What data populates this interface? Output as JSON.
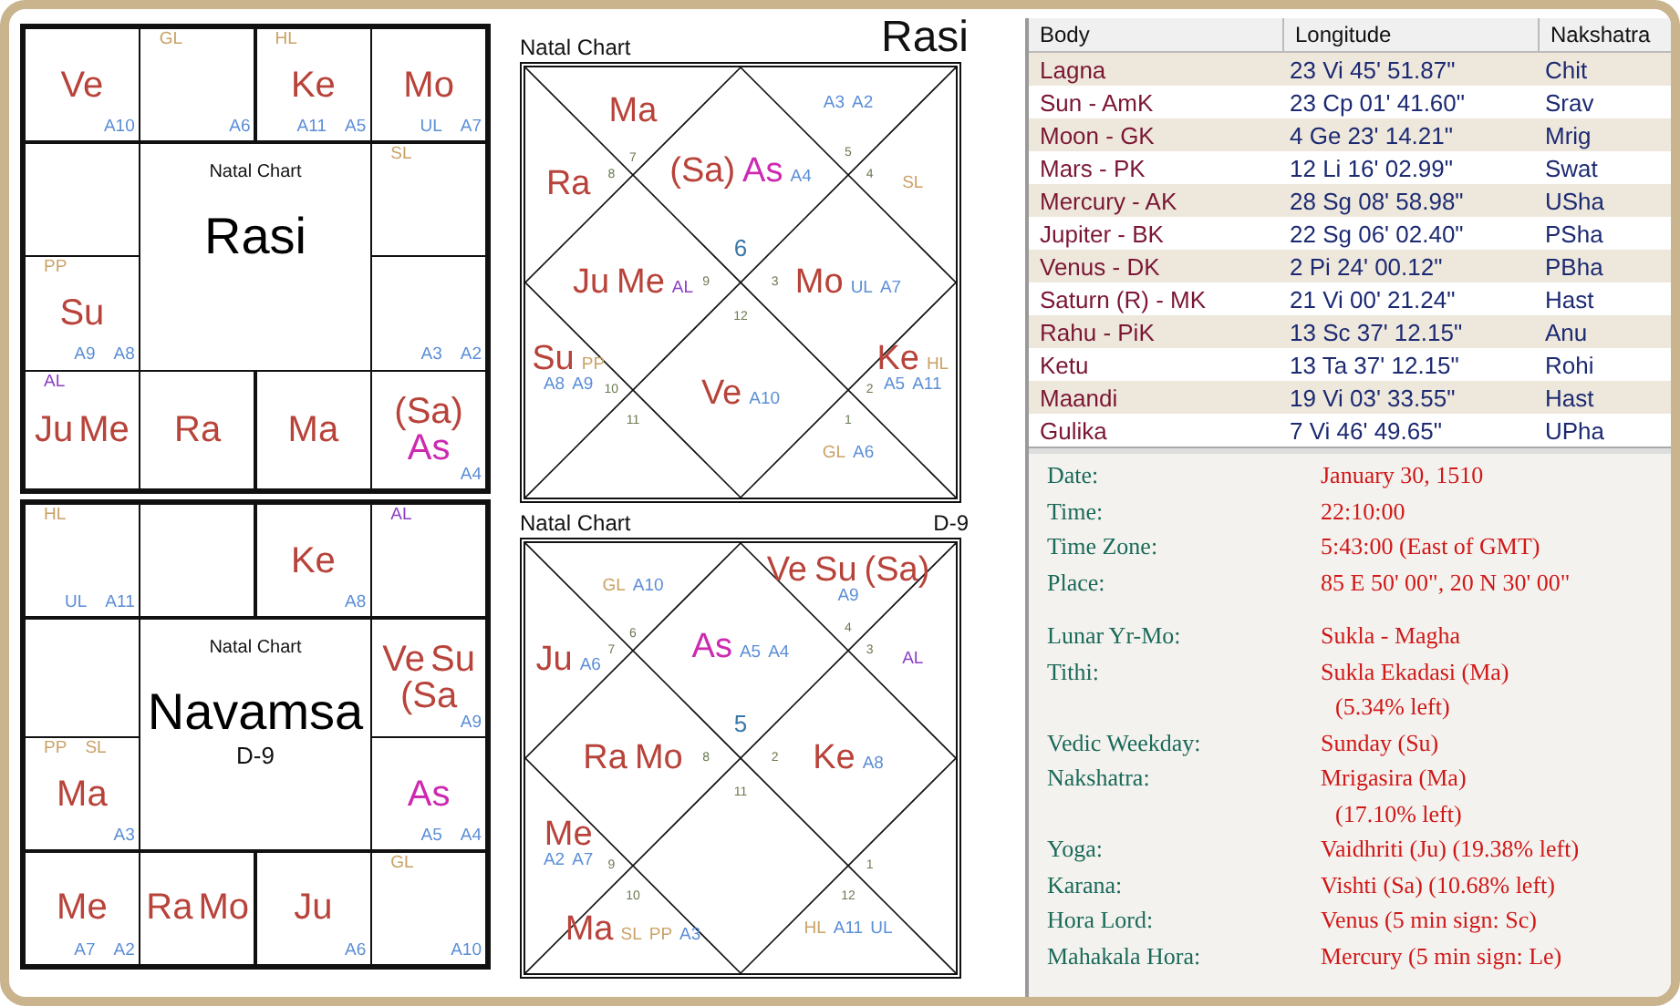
{
  "south_charts": [
    {
      "title": "Natal Chart",
      "name": "Rasi",
      "cells": [
        {
          "planets": [
            {
              "text": "Ve",
              "color": "#b8433a"
            }
          ],
          "bottom": [
            {
              "text": "A10",
              "color": "#5b8ed6"
            }
          ]
        },
        {
          "top": [
            {
              "text": "GL",
              "color": "#c9a266"
            }
          ],
          "bottom": [
            {
              "text": "A6",
              "color": "#5b8ed6"
            }
          ]
        },
        {
          "top": [
            {
              "text": "HL",
              "color": "#c9a266"
            }
          ],
          "planets": [
            {
              "text": "Ke",
              "color": "#b8433a"
            }
          ],
          "bottom": [
            {
              "text": "A11",
              "color": "#5b8ed6"
            },
            {
              "text": "A5",
              "color": "#5b8ed6"
            }
          ]
        },
        {
          "planets": [
            {
              "text": "Mo",
              "color": "#b8433a"
            }
          ],
          "bottom": [
            {
              "text": "UL",
              "color": "#5b8ed6"
            },
            {
              "text": "A7",
              "color": "#5b8ed6"
            }
          ]
        },
        {},
        {
          "top": [
            {
              "text": "SL",
              "color": "#c9a266"
            }
          ]
        },
        {
          "top": [
            {
              "text": "PP",
              "color": "#c9a266"
            }
          ],
          "planets": [
            {
              "text": "Su",
              "color": "#b8433a"
            }
          ],
          "bottom": [
            {
              "text": "A9",
              "color": "#5b8ed6"
            },
            {
              "text": "A8",
              "color": "#5b8ed6"
            }
          ]
        },
        {
          "bottom": [
            {
              "text": "A3",
              "color": "#5b8ed6"
            },
            {
              "text": "A2",
              "color": "#5b8ed6"
            }
          ]
        },
        {
          "top": [
            {
              "text": "AL",
              "color": "#8b3fc4"
            }
          ],
          "planets": [
            {
              "text": "Ju",
              "color": "#b8433a"
            },
            {
              "text": "Me",
              "color": "#b8433a"
            }
          ]
        },
        {
          "planets": [
            {
              "text": "Ra",
              "color": "#b8433a"
            }
          ]
        },
        {
          "planets": [
            {
              "text": "Ma",
              "color": "#b8433a"
            }
          ]
        },
        {
          "planets": [
            {
              "text": "(Sa)",
              "color": "#b8433a"
            },
            {
              "text": "As",
              "color": "#cc2ab0"
            }
          ],
          "bottom": [
            {
              "text": "A4",
              "color": "#5b8ed6"
            }
          ]
        }
      ]
    },
    {
      "title": "Natal Chart",
      "name": "Navamsa",
      "subtitle": "D-9",
      "cells": [
        {
          "top": [
            {
              "text": "HL",
              "color": "#c9a266"
            }
          ],
          "bottom": [
            {
              "text": "UL",
              "color": "#5b8ed6"
            },
            {
              "text": "A11",
              "color": "#5b8ed6"
            }
          ]
        },
        {},
        {
          "planets": [
            {
              "text": "Ke",
              "color": "#b8433a"
            }
          ],
          "bottom": [
            {
              "text": "A8",
              "color": "#5b8ed6"
            }
          ]
        },
        {
          "top": [
            {
              "text": "AL",
              "color": "#8b3fc4"
            }
          ]
        },
        {},
        {
          "planets": [
            {
              "text": "Ve",
              "color": "#b8433a"
            },
            {
              "text": "Su",
              "color": "#b8433a"
            },
            {
              "text": "(Sa",
              "color": "#b8433a"
            }
          ],
          "bottom": [
            {
              "text": "A9",
              "color": "#5b8ed6"
            }
          ]
        },
        {
          "top": [
            {
              "text": "PP",
              "color": "#c9a266"
            },
            {
              "text": "SL",
              "color": "#c9a266"
            }
          ],
          "planets": [
            {
              "text": "Ma",
              "color": "#b8433a"
            }
          ],
          "bottom": [
            {
              "text": "A3",
              "color": "#5b8ed6"
            }
          ]
        },
        {
          "planets": [
            {
              "text": "As",
              "color": "#cc2ab0"
            }
          ],
          "bottom": [
            {
              "text": "A5",
              "color": "#5b8ed6"
            },
            {
              "text": "A4",
              "color": "#5b8ed6"
            }
          ]
        },
        {
          "planets": [
            {
              "text": "Me",
              "color": "#b8433a"
            }
          ],
          "bottom": [
            {
              "text": "A7",
              "color": "#5b8ed6"
            },
            {
              "text": "A2",
              "color": "#5b8ed6"
            }
          ]
        },
        {
          "planets": [
            {
              "text": "Ra",
              "color": "#b8433a"
            },
            {
              "text": "Mo",
              "color": "#b8433a"
            }
          ]
        },
        {
          "planets": [
            {
              "text": "Ju",
              "color": "#b8433a"
            }
          ],
          "bottom": [
            {
              "text": "A6",
              "color": "#5b8ed6"
            }
          ]
        },
        {
          "top": [
            {
              "text": "GL",
              "color": "#c9a266"
            }
          ],
          "bottom": [
            {
              "text": "A10",
              "color": "#5b8ed6"
            }
          ]
        }
      ]
    }
  ],
  "north_charts": [
    {
      "title": "Natal Chart",
      "label": "Rasi",
      "kind": "rasi",
      "houses": [
        {
          "sign": "7",
          "planets": [
            {
              "text": "Ma",
              "color": "#b8433a"
            }
          ]
        },
        {
          "sign": "5",
          "labels": [
            {
              "text": "A3",
              "color": "#5b8ed6"
            },
            {
              "text": "A2",
              "color": "#5b8ed6"
            }
          ]
        },
        {
          "sign": "6",
          "planets": [
            {
              "text": "(Sa)",
              "color": "#b8433a"
            },
            {
              "text": "As",
              "color": "#cc2ab0"
            }
          ],
          "labels": [
            {
              "text": "A4",
              "color": "#5b8ed6"
            }
          ]
        },
        {
          "sign": "8",
          "planets": [
            {
              "text": "Ra",
              "color": "#b8433a"
            }
          ]
        },
        {
          "sign": "4",
          "labels": [
            {
              "text": "SL",
              "color": "#c9a266"
            }
          ]
        },
        {
          "sign": "9",
          "planets": [
            {
              "text": "Ju",
              "color": "#b8433a"
            },
            {
              "text": "Me",
              "color": "#b8433a"
            }
          ],
          "labels": [
            {
              "text": "AL",
              "color": "#8b3fc4"
            }
          ]
        },
        {
          "sign": "3",
          "planets": [
            {
              "text": "Mo",
              "color": "#b8433a"
            }
          ],
          "labels": [
            {
              "text": "UL",
              "color": "#5b8ed6"
            },
            {
              "text": "A7",
              "color": "#5b8ed6"
            }
          ]
        },
        {
          "sign": "10",
          "planets": [
            {
              "text": "Su",
              "color": "#b8433a"
            }
          ],
          "labels": [
            {
              "text": "PP",
              "color": "#c9a266"
            },
            {
              "text": "A8",
              "color": "#5b8ed6"
            },
            {
              "text": "A9",
              "color": "#5b8ed6"
            }
          ]
        },
        {
          "sign": "12",
          "planets": [
            {
              "text": "Ve",
              "color": "#b8433a"
            }
          ],
          "labels": [
            {
              "text": "A10",
              "color": "#5b8ed6"
            }
          ]
        },
        {
          "sign": "2",
          "planets": [
            {
              "text": "Ke",
              "color": "#b8433a"
            }
          ],
          "labels": [
            {
              "text": "HL",
              "color": "#c9a266"
            },
            {
              "text": "A5",
              "color": "#5b8ed6"
            },
            {
              "text": "A11",
              "color": "#5b8ed6"
            }
          ]
        },
        {
          "sign": "11"
        },
        {
          "sign": "1",
          "labels": [
            {
              "text": "GL",
              "color": "#c9a266"
            },
            {
              "text": "A6",
              "color": "#5b8ed6"
            }
          ]
        }
      ]
    },
    {
      "title": "Natal Chart",
      "label": "D-9",
      "kind": "varga",
      "houses": [
        {
          "sign": "6",
          "labels": [
            {
              "text": "GL",
              "color": "#c9a266"
            },
            {
              "text": "A10",
              "color": "#5b8ed6"
            }
          ]
        },
        {
          "sign": "4",
          "planets": [
            {
              "text": "Ve",
              "color": "#b8433a"
            },
            {
              "text": "Su",
              "color": "#b8433a"
            },
            {
              "text": "(Sa)",
              "color": "#b8433a"
            }
          ],
          "labels": [
            {
              "text": "A9",
              "color": "#5b8ed6"
            }
          ]
        },
        {
          "sign": "5",
          "planets": [
            {
              "text": "As",
              "color": "#cc2ab0"
            }
          ],
          "labels": [
            {
              "text": "A5",
              "color": "#5b8ed6"
            },
            {
              "text": "A4",
              "color": "#5b8ed6"
            }
          ]
        },
        {
          "sign": "7",
          "planets": [
            {
              "text": "Ju",
              "color": "#b8433a"
            }
          ],
          "labels": [
            {
              "text": "A6",
              "color": "#5b8ed6"
            }
          ]
        },
        {
          "sign": "3",
          "labels": [
            {
              "text": "AL",
              "color": "#8b3fc4"
            }
          ]
        },
        {
          "sign": "8",
          "planets": [
            {
              "text": "Ra",
              "color": "#b8433a"
            },
            {
              "text": "Mo",
              "color": "#b8433a"
            }
          ]
        },
        {
          "sign": "2",
          "planets": [
            {
              "text": "Ke",
              "color": "#b8433a"
            }
          ],
          "labels": [
            {
              "text": "A8",
              "color": "#5b8ed6"
            }
          ]
        },
        {
          "sign": "9",
          "planets": [
            {
              "text": "Me",
              "color": "#b8433a"
            }
          ],
          "labels": [
            {
              "text": "A2",
              "color": "#5b8ed6"
            },
            {
              "text": "A7",
              "color": "#5b8ed6"
            }
          ]
        },
        {
          "sign": "11"
        },
        {
          "sign": "1"
        },
        {
          "sign": "10",
          "planets": [
            {
              "text": "Ma",
              "color": "#b8433a"
            }
          ],
          "labels": [
            {
              "text": "SL",
              "color": "#c9a266"
            },
            {
              "text": "PP",
              "color": "#c9a266"
            },
            {
              "text": "A3",
              "color": "#5b8ed6"
            }
          ]
        },
        {
          "sign": "12",
          "labels": [
            {
              "text": "HL",
              "color": "#c9a266"
            },
            {
              "text": "A11",
              "color": "#5b8ed6"
            },
            {
              "text": "UL",
              "color": "#5b8ed6"
            }
          ]
        }
      ]
    }
  ],
  "table": {
    "columns": [
      "Body",
      "Longitude",
      "Nakshatra"
    ],
    "rows": [
      [
        "Lagna",
        "23 Vi 45' 51.87\"",
        "Chit"
      ],
      [
        "Sun - AmK",
        "23 Cp 01' 41.60\"",
        "Srav"
      ],
      [
        "Moon - GK",
        "4 Ge 23' 14.21\"",
        "Mrig"
      ],
      [
        "Mars - PK",
        "12 Li 16' 02.99\"",
        "Swat"
      ],
      [
        "Mercury - AK",
        "28 Sg 08' 58.98\"",
        "USha"
      ],
      [
        "Jupiter - BK",
        "22 Sg 06' 02.40\"",
        "PSha"
      ],
      [
        "Venus - DK",
        "2 Pi 24' 00.12\"",
        "PBha"
      ],
      [
        "Saturn (R) - MK",
        "21 Vi 00' 21.24\"",
        "Hast"
      ],
      [
        "Rahu - PiK",
        "13 Sc 37' 12.15\"",
        "Anu"
      ],
      [
        "Ketu",
        "13 Ta 37' 12.15\"",
        "Rohi"
      ],
      [
        "Maandi",
        "19 Vi 03' 33.55\"",
        "Hast"
      ],
      [
        "Gulika",
        "7 Vi 46' 49.65\"",
        "UPha"
      ]
    ]
  },
  "details": [
    [
      {
        "label": "Date:",
        "value": "January 30, 1510"
      },
      {
        "label": "Time:",
        "value": "22:10:00"
      },
      {
        "label": "Time Zone:",
        "value": "5:43:00 (East of GMT)"
      },
      {
        "label": "Place:",
        "value": "85 E 50' 00\", 20 N 30' 00\""
      }
    ],
    [
      {
        "label": "Lunar Yr-Mo:",
        "value": "Sukla - Magha"
      },
      {
        "label": "Tithi:",
        "value": "Sukla Ekadasi (Ma)",
        "continuation": "(5.34% left)"
      },
      {
        "label": "Vedic Weekday:",
        "value": "Sunday (Su)"
      },
      {
        "label": "Nakshatra:",
        "value": "Mrigasira (Ma)",
        "continuation": "(17.10% left)"
      },
      {
        "label": "Yoga:",
        "value": "Vaidhriti (Ju) (19.38% left)"
      },
      {
        "label": "Karana:",
        "value": "Vishti (Sa) (10.68% left)"
      },
      {
        "label": "Hora Lord:",
        "value": "Venus (5 min sign: Sc)"
      },
      {
        "label": "Mahakala Hora:",
        "value": "Mercury (5 min sign: Le)"
      }
    ]
  ]
}
